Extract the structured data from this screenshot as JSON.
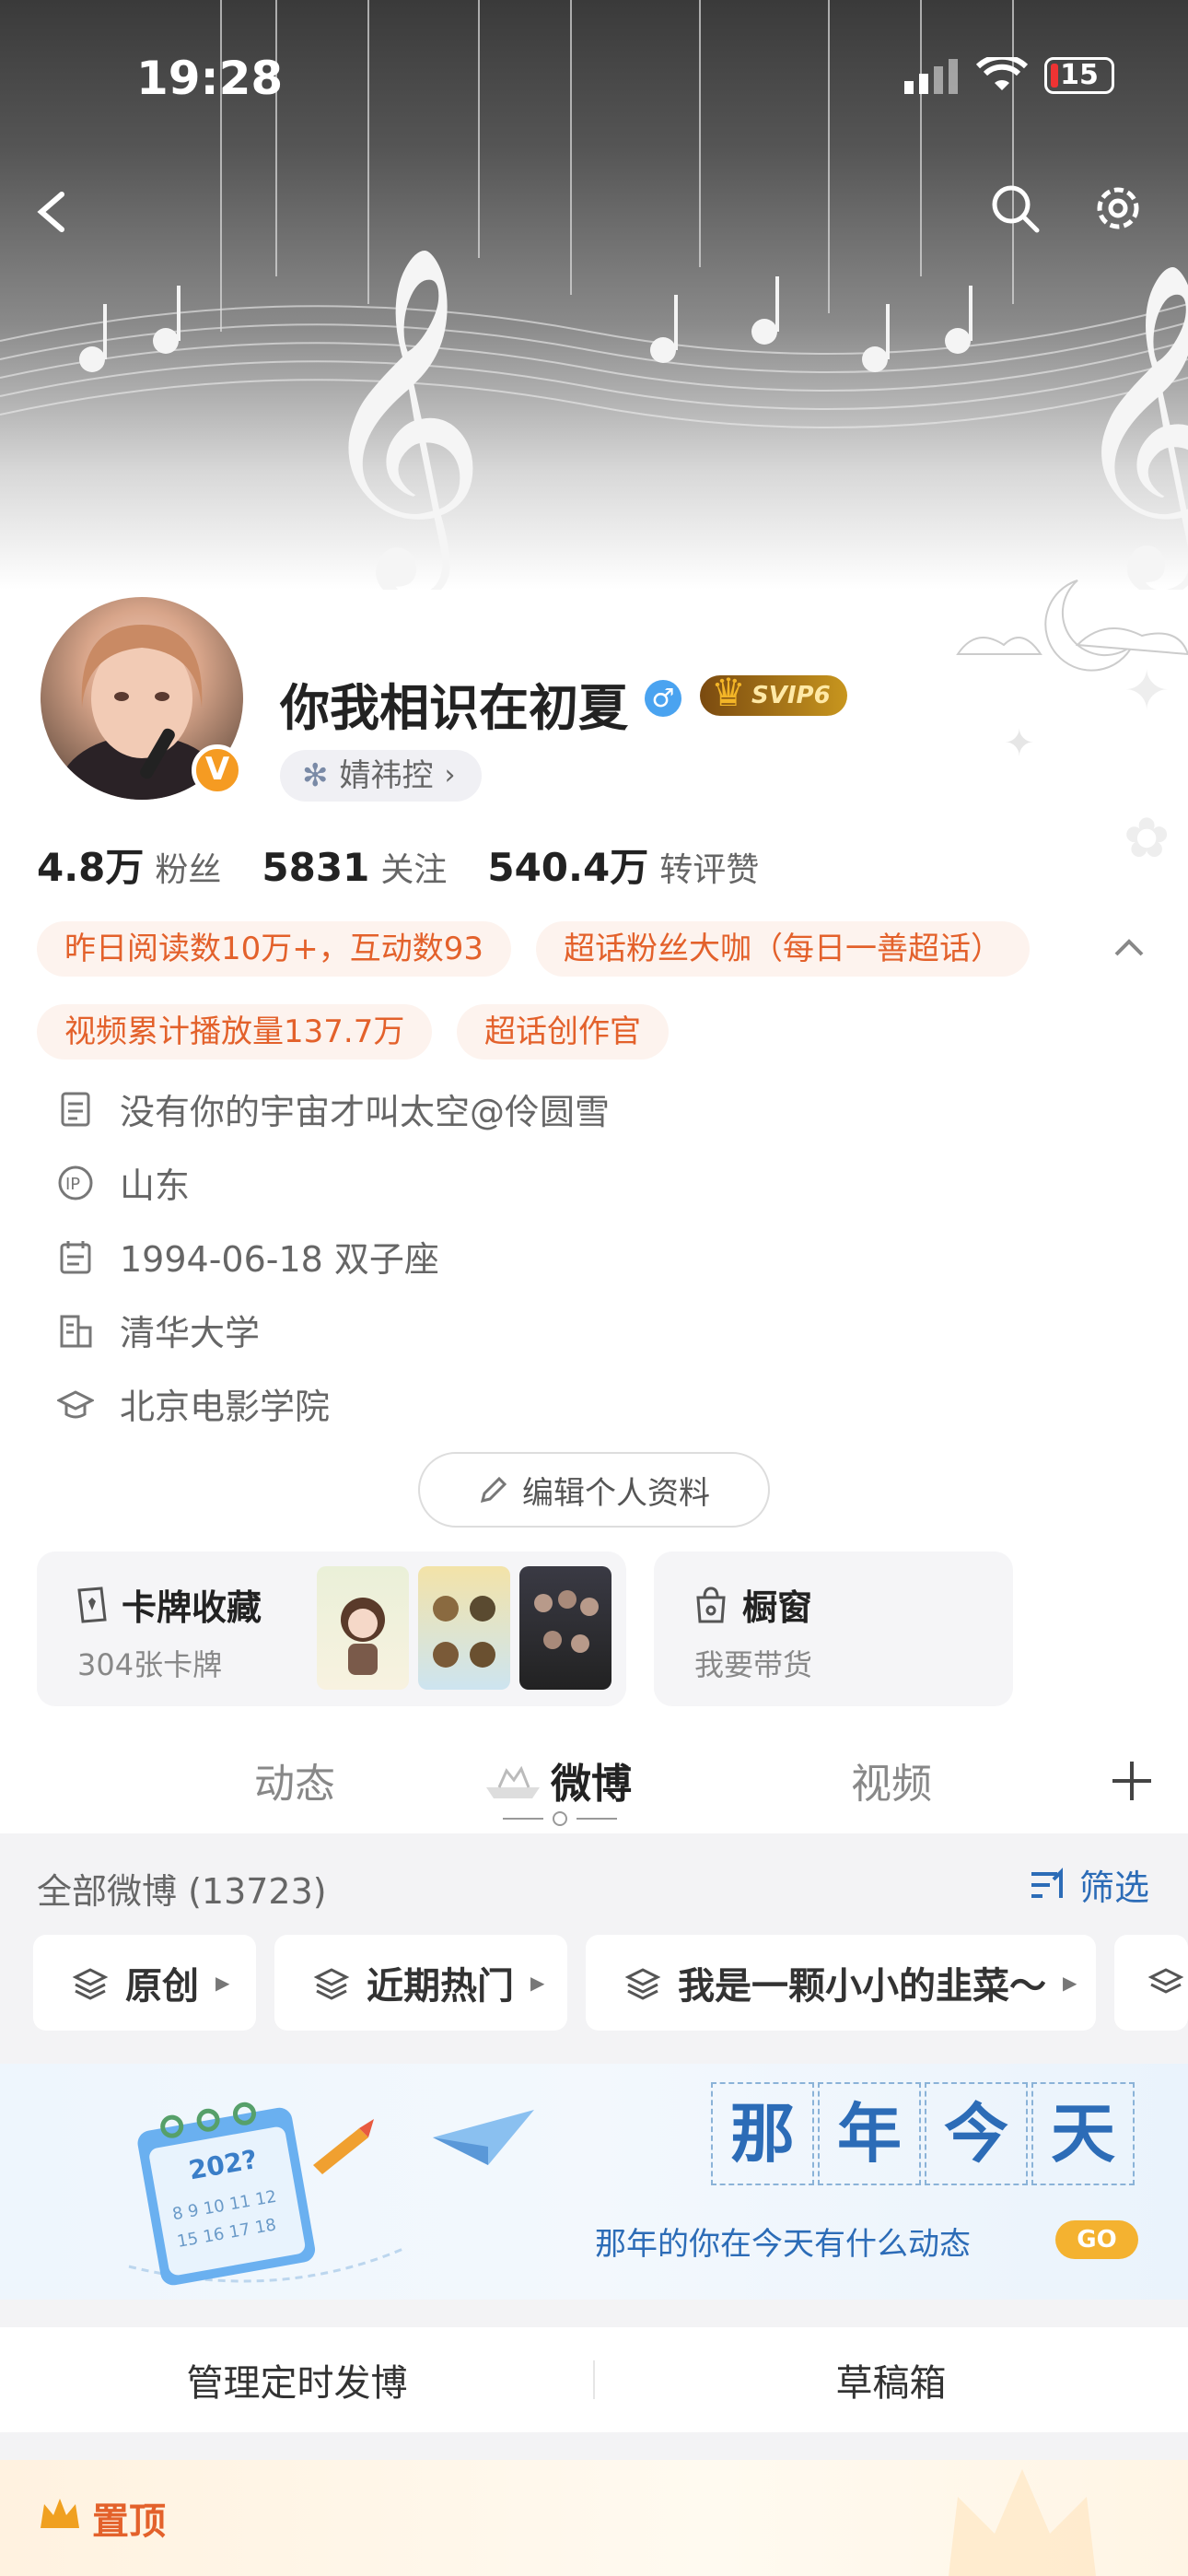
{
  "status": {
    "time": "19:28",
    "battery": "15"
  },
  "profile": {
    "nickname": "你我相识在初夏",
    "gender_symbol": "♂",
    "svip": "SVIP6",
    "verified": "V",
    "fan_club": "婧祎控"
  },
  "stats": [
    {
      "value": "4.8万",
      "label": "粉丝"
    },
    {
      "value": "5831",
      "label": "关注"
    },
    {
      "value": "540.4万",
      "label": "转评赞"
    }
  ],
  "tags": [
    "昨日阅读数10万+，互动数93",
    "超话粉丝大咖（每日一善超话）",
    "视频累计播放量137.7万",
    "超话创作官"
  ],
  "info": {
    "bio": "没有你的宇宙才叫太空@伶圆雪",
    "ip": "山东",
    "birthday": "1994-06-18 双子座",
    "company": "清华大学",
    "school": "北京电影学院"
  },
  "edit_profile": "编辑个人资料",
  "cards": {
    "collection": {
      "title": "卡牌收藏",
      "subtitle": "304张卡牌"
    },
    "shop": {
      "title": "橱窗",
      "subtitle": "我要带货"
    }
  },
  "tabs": [
    "动态",
    "微博",
    "视频"
  ],
  "feed": {
    "header": "全部微博 (13723)",
    "filter": "筛选",
    "chips": [
      "原创",
      "近期热门",
      "我是一颗小小的韭菜～"
    ]
  },
  "on_this_day": {
    "chars": [
      "那",
      "年",
      "今",
      "天"
    ],
    "subtitle": "那年的你在今天有什么动态",
    "go": "GO",
    "calendar": "202?"
  },
  "actions": {
    "scheduled": "管理定时发博",
    "drafts": "草稿箱"
  },
  "pinned": {
    "label": "置顶"
  },
  "colors": {
    "accent": "#e3612b",
    "link": "#2c6cb7",
    "verified": "#f59b22"
  }
}
